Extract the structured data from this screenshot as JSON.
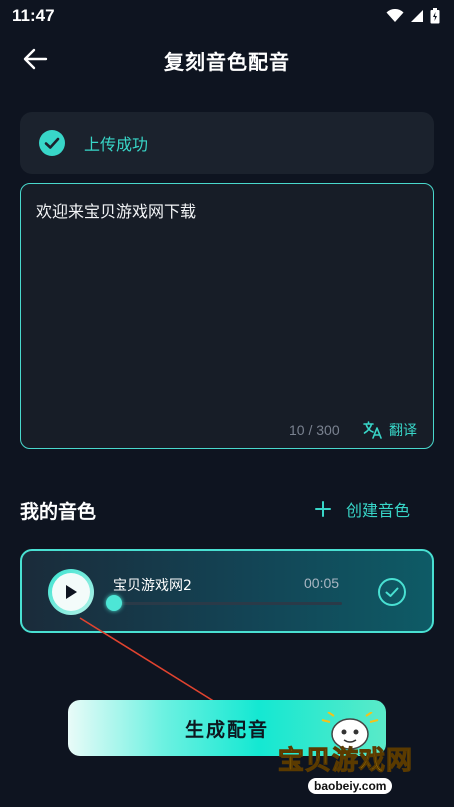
{
  "status_bar": {
    "time": "11:47"
  },
  "header": {
    "title": "复刻音色配音"
  },
  "upload": {
    "status_text": "上传成功"
  },
  "text_input": {
    "value": "欢迎来宝贝游戏网下载",
    "char_count": "10 / 300",
    "translate_label": "翻译"
  },
  "voices_section": {
    "title": "我的音色",
    "create_label": "创建音色",
    "items": [
      {
        "name": "宝贝游戏网2",
        "duration": "00:05",
        "progress": 0,
        "selected": true
      }
    ]
  },
  "generate": {
    "label": "生成配音"
  },
  "watermark": {
    "text": "宝贝游戏网",
    "url": "baobeiy.com"
  },
  "colors": {
    "accent": "#38d6c8",
    "background": "#0e1420",
    "card": "#1b222d",
    "annotation_arrow": "#e0432f"
  }
}
